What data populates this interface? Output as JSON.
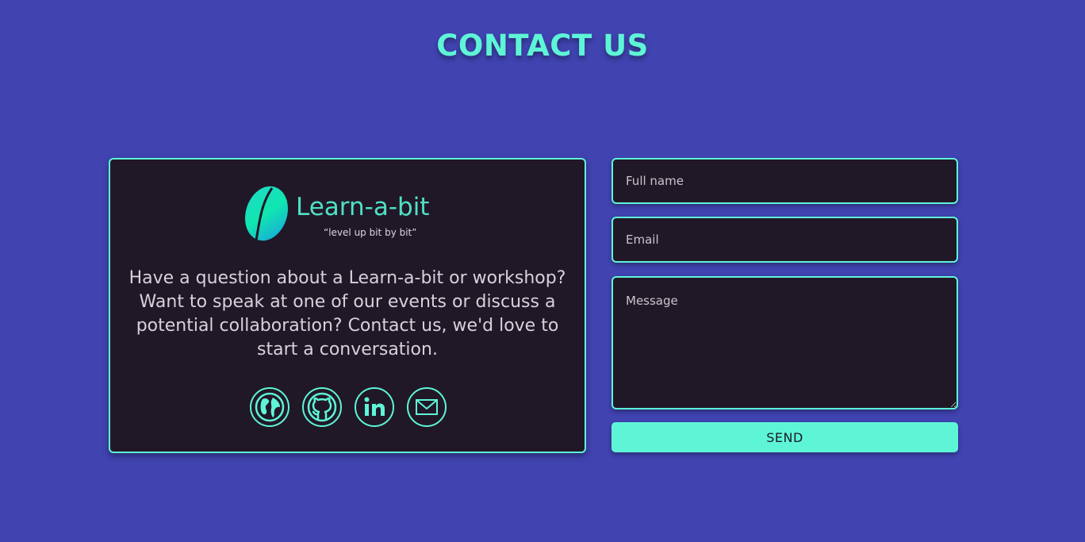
{
  "header": {
    "title": "CONTACT US"
  },
  "info": {
    "logo_name": "Learn-a-bit",
    "logo_tagline": "“level up bit by bit”",
    "blurb": "Have a question about a Learn-a-bit or workshop? Want to speak at one of our events or discuss a potential collaboration? Contact us, we'd love to start a conversation.",
    "socials": [
      {
        "icon": "globe-icon"
      },
      {
        "icon": "github-icon"
      },
      {
        "icon": "linkedin-icon"
      },
      {
        "icon": "mail-icon"
      }
    ]
  },
  "form": {
    "name_placeholder": "Full name",
    "email_placeholder": "Email",
    "message_placeholder": "Message",
    "send_label": "SEND"
  },
  "colors": {
    "background": "#4043b0",
    "accent": "#5ef5d7",
    "card": "#211827"
  }
}
